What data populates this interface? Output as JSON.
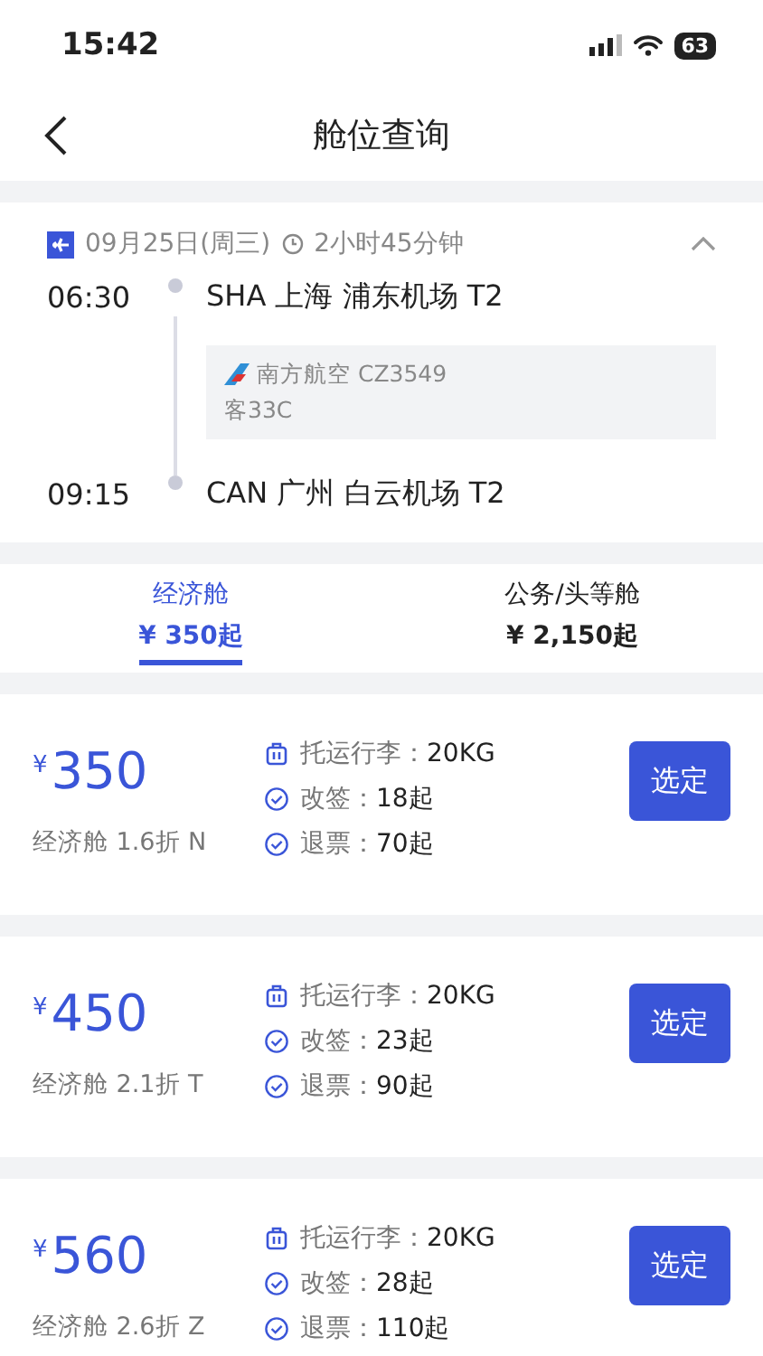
{
  "status_bar": {
    "time": "15:42",
    "battery": "63"
  },
  "nav": {
    "title": "舱位查询"
  },
  "flight": {
    "date": "09月25日(周三)",
    "duration": "2小时45分钟",
    "expanded": true,
    "departure": {
      "time": "06:30",
      "place": "SHA 上海 浦东机场 T2"
    },
    "carrier": {
      "airline": "南方航空 CZ3549",
      "aircraft": "客33C"
    },
    "arrival": {
      "time": "09:15",
      "place": "CAN 广州 白云机场 T2"
    }
  },
  "tabs": [
    {
      "label": "经济舱",
      "price": "¥ 350起",
      "selected": true
    },
    {
      "label": "公务/头等舱",
      "price": "¥ 2,150起",
      "selected": false
    }
  ],
  "fares": [
    {
      "currency": "¥",
      "price": "350",
      "cabin": "经济舱 1.6折 N",
      "rules": [
        {
          "kind": "baggage",
          "label": "托运行李：",
          "value": "20KG"
        },
        {
          "kind": "check",
          "label": "改签：",
          "value": "18起"
        },
        {
          "kind": "check",
          "label": "退票：",
          "value": "70起"
        }
      ],
      "button": "选定"
    },
    {
      "currency": "¥",
      "price": "450",
      "cabin": "经济舱 2.1折 T",
      "rules": [
        {
          "kind": "baggage",
          "label": "托运行李：",
          "value": "20KG"
        },
        {
          "kind": "check",
          "label": "改签：",
          "value": "23起"
        },
        {
          "kind": "check",
          "label": "退票：",
          "value": "90起"
        }
      ],
      "button": "选定"
    },
    {
      "currency": "¥",
      "price": "560",
      "cabin": "经济舱 2.6折 Z",
      "rules": [
        {
          "kind": "baggage",
          "label": "托运行李：",
          "value": "20KG"
        },
        {
          "kind": "check",
          "label": "改签：",
          "value": "28起"
        },
        {
          "kind": "check",
          "label": "退票：",
          "value": "110起"
        }
      ],
      "button": "选定"
    }
  ]
}
